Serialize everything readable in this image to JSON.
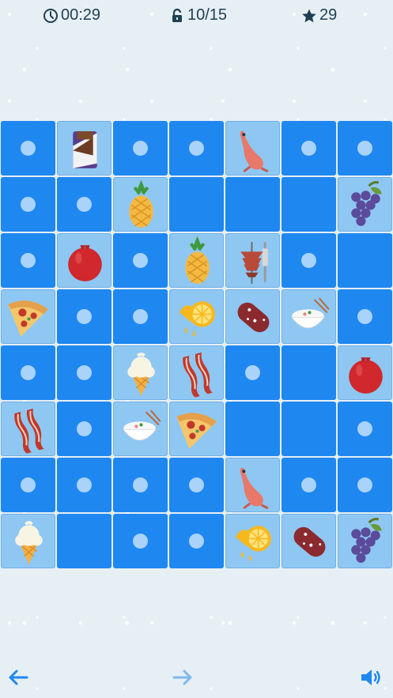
{
  "header": {
    "timer": "00:29",
    "progress_text": "10/15",
    "stars": "29",
    "icons": {
      "timer": "clock-icon",
      "progress": "unlock-icon",
      "stars": "star-icon"
    }
  },
  "colors": {
    "hidden_tile": "#1f87f0",
    "revealed_tile": "#8fc7f3",
    "tile_dot": "#a9d3fb",
    "text": "#1f3f52",
    "arrow": "#1f87f0"
  },
  "board": {
    "rows": 8,
    "cols": 7,
    "cells": [
      [
        "dot",
        "chocolate",
        "dot",
        "dot",
        "shrimp",
        "dot",
        "dot"
      ],
      [
        "dot",
        "dot",
        "pineapple",
        "blank",
        "blank",
        "blank",
        "grapes"
      ],
      [
        "dot",
        "pomegranate",
        "dot",
        "pineapple",
        "kebab",
        "dot",
        "blank"
      ],
      [
        "pizza",
        "dot",
        "dot",
        "lemon",
        "sausage",
        "rice-bowl",
        "dot"
      ],
      [
        "dot",
        "dot",
        "ice-cream",
        "bacon",
        "dot",
        "blank",
        "pomegranate"
      ],
      [
        "bacon",
        "dot",
        "rice-bowl",
        "pizza",
        "blank",
        "blank",
        "dot"
      ],
      [
        "dot",
        "dot",
        "dot",
        "dot",
        "shrimp",
        "dot",
        "dot"
      ],
      [
        "ice-cream",
        "blank",
        "dot",
        "dot",
        "lemon",
        "sausage",
        "grapes"
      ]
    ]
  },
  "footer": {
    "back_icon": "arrow-left-icon",
    "next_icon": "arrow-right-icon",
    "sound_icon": "speaker-icon"
  }
}
